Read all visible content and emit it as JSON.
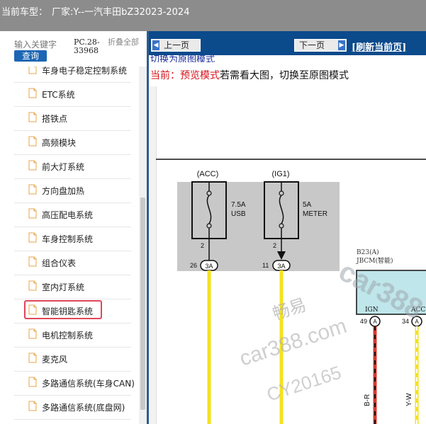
{
  "header": {
    "label": "当前车型：",
    "model": "厂家:Y--一汽丰田bZ32023-2024"
  },
  "search": {
    "placeholder": "输入关键字",
    "button": "查询",
    "code": "PC.28-33968",
    "collapse": "折叠全部"
  },
  "tree": {
    "items": [
      {
        "label": "车身电子稳定控制系统",
        "selected": false
      },
      {
        "label": "ETC系统",
        "selected": false
      },
      {
        "label": "搭铁点",
        "selected": false
      },
      {
        "label": "高频模块",
        "selected": false
      },
      {
        "label": "前大灯系统",
        "selected": false
      },
      {
        "label": "方向盘加热",
        "selected": false
      },
      {
        "label": "高压配电系统",
        "selected": false
      },
      {
        "label": "车身控制系统",
        "selected": false
      },
      {
        "label": "组合仪表",
        "selected": false
      },
      {
        "label": "室内灯系统",
        "selected": false
      },
      {
        "label": "智能钥匙系统",
        "selected": true
      },
      {
        "label": "电机控制系统",
        "selected": false
      },
      {
        "label": "麦克风",
        "selected": false
      },
      {
        "label": "多路通信系统(车身CAN)",
        "selected": false
      },
      {
        "label": "多路通信系统(底盘网)",
        "selected": false
      }
    ]
  },
  "nav": {
    "prev": "上一页",
    "next": "下一页",
    "refresh": "[刷新当前页]"
  },
  "viewer": {
    "switch_link": "切换为原图模式",
    "mode_prefix": "当前：",
    "mode_name": "预览模式",
    "mode_suffix": "若需看大图，切换至原图模式"
  },
  "diagram": {
    "fuse1_bus": "(ACC)",
    "fuse1_amp": "7.5A",
    "fuse1_name": "USB",
    "fuse2_bus": "(IG1)",
    "fuse2_amp": "5A",
    "fuse2_name": "METER",
    "fuse1_pin": "2",
    "fuse2_pin": "2",
    "conn1_num": "26",
    "conn1": "3A",
    "conn2_num": "11",
    "conn2": "3A",
    "ecu_code": "B23(A)",
    "ecu_name": "JBCM(智能)",
    "ecu_pin1": "IGN",
    "ecu_pin2": "ACC",
    "ecu_pin1_num": "49",
    "ecu_pin1_conn": "A",
    "ecu_pin2_num": "34",
    "ecu_pin2_conn": "A",
    "wire1_color": "B-R",
    "wire2_color": "Y-W"
  },
  "watermark": {
    "line1": "畅易",
    "line2": "car388.com",
    "line3": "CY20165",
    "logo": "car388"
  },
  "colors": {
    "nav": "#0b4a8b",
    "header": "#8c8c8c",
    "selected_border": "#e0465a",
    "wire_yellow": "#f4e21d",
    "ecu_fill": "#bfe6ea"
  }
}
